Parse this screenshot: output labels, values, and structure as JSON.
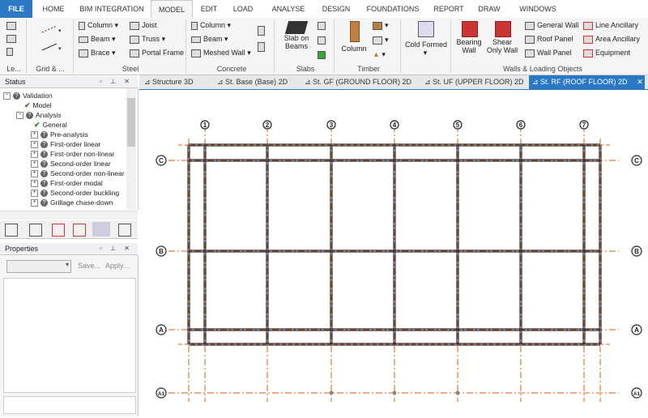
{
  "ribbon_tabs": [
    {
      "label": "FILE"
    },
    {
      "label": "HOME"
    },
    {
      "label": "BIM INTEGRATION"
    },
    {
      "label": "MODEL"
    },
    {
      "label": "EDIT"
    },
    {
      "label": "LOAD"
    },
    {
      "label": "ANALYSE"
    },
    {
      "label": "DESIGN"
    },
    {
      "label": "FOUNDATIONS"
    },
    {
      "label": "REPORT"
    },
    {
      "label": "DRAW"
    },
    {
      "label": "WINDOWS"
    }
  ],
  "ribbon": {
    "groups": {
      "levels": "Le...",
      "grid": "Grid & ...",
      "steel": "Steel",
      "concrete": "Concrete",
      "slabs": "Slabs",
      "timber": "Timber",
      "walls": "Walls & Loading Objects"
    },
    "steel": {
      "column": "Column",
      "beam": "Beam",
      "brace": "Brace",
      "joist": "Joist",
      "truss": "Truss",
      "portal": "Portal Frame"
    },
    "concrete": {
      "column": "Column",
      "beam": "Beam",
      "meshed_wall": "Meshed Wall"
    },
    "slabs": {
      "slab_on_beams_1": "Slab on",
      "slab_on_beams_2": "Beams"
    },
    "timber": {
      "column": "Column"
    },
    "cold_formed": "Cold Formed",
    "walls": {
      "bearing_1": "Bearing",
      "bearing_2": "Wall",
      "shear_1": "Shear",
      "shear_2": "Only Wall",
      "general_wall": "General Wall",
      "roof_panel": "Roof Panel",
      "wall_panel": "Wall Panel",
      "line_ancillary": "Line Ancillary",
      "area_ancillary": "Area Ancillary",
      "equipment": "Equipment"
    }
  },
  "status_panel": {
    "title": "Status",
    "tree": [
      "Validation",
      "Model",
      "Analysis",
      "General",
      "Pre-analysis",
      "First-order linear",
      "First-order non-linear",
      "Second-order linear",
      "Second-order non-linear",
      "First-order modal",
      "Second-order buckling",
      "Grillage chase-down"
    ]
  },
  "properties_panel": {
    "title": "Properties",
    "save": "Save...",
    "apply": "Apply..."
  },
  "doc_tabs": [
    {
      "label": "Structure 3D"
    },
    {
      "label": "St. Base (Base) 2D"
    },
    {
      "label": "St. GF (GROUND FLOOR) 2D"
    },
    {
      "label": "St. UF (UPPER FLOOR) 2D"
    },
    {
      "label": "St. RF (ROOF FLOOR) 2D"
    }
  ],
  "grid": {
    "columns": [
      "1",
      "2",
      "3",
      "4",
      "5",
      "6",
      "7"
    ],
    "rows": [
      "C",
      "B",
      "A",
      "A1"
    ]
  },
  "colors": {
    "accent": "#2b78c5",
    "grid_line": "#e85c00",
    "beam": "#2a2f3a"
  }
}
